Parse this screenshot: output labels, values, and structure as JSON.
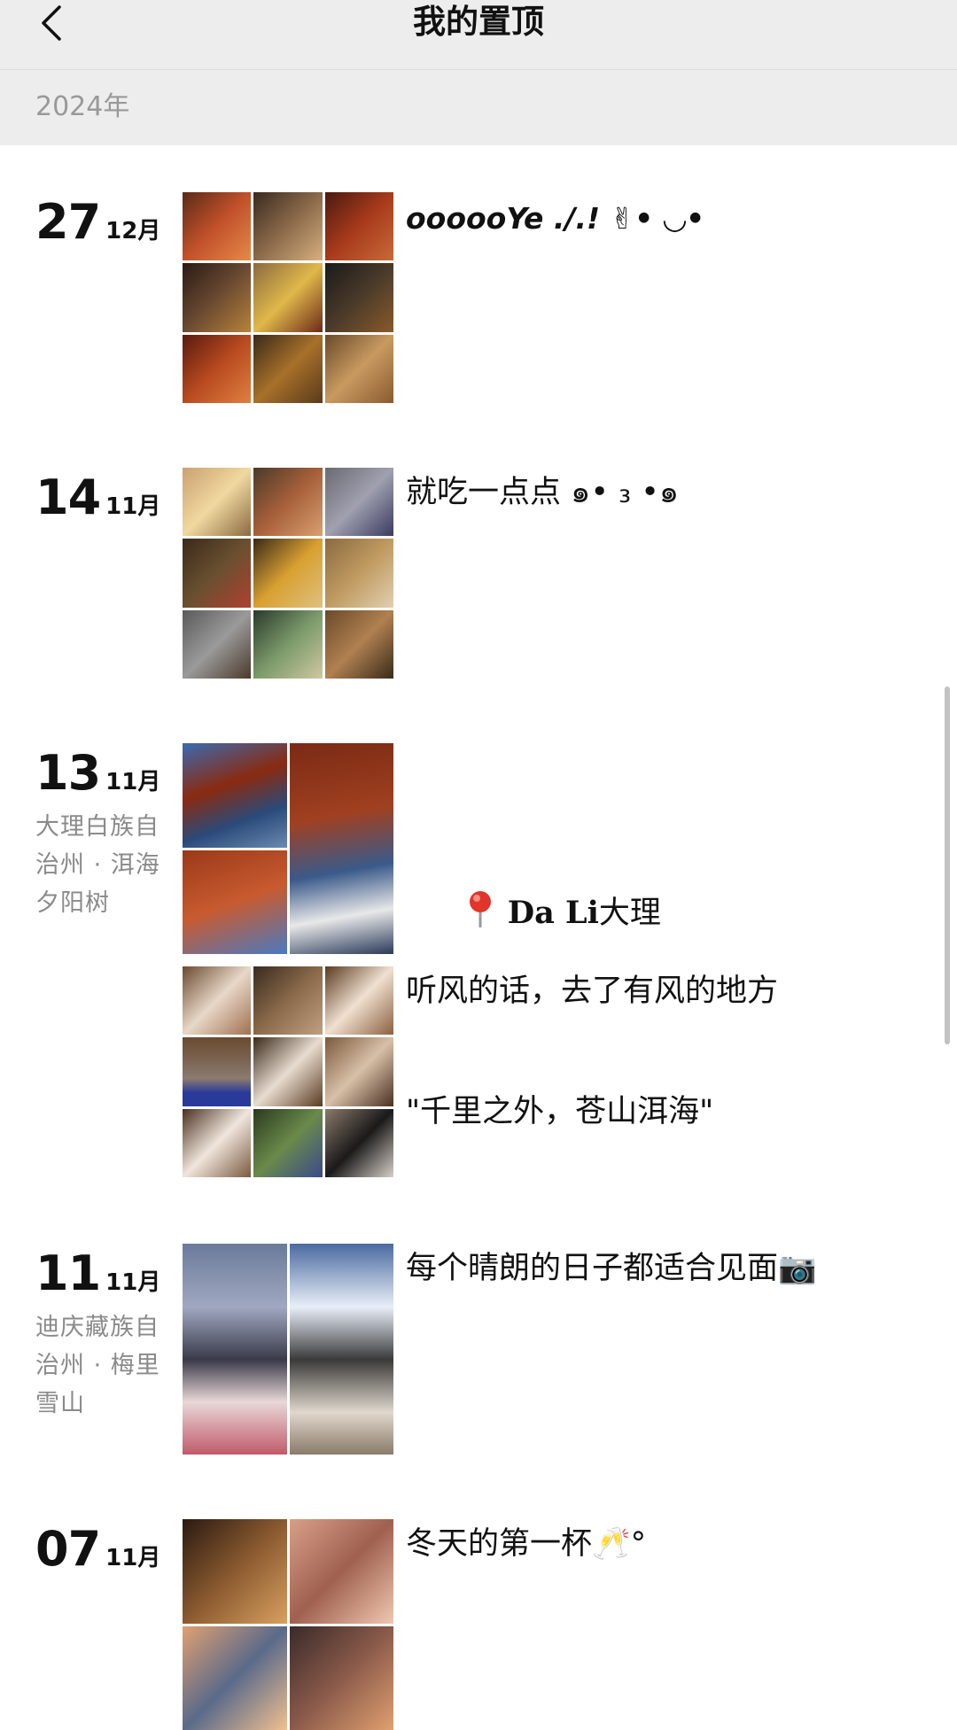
{
  "header": {
    "title": "我的置顶",
    "back_icon": "back-arrow-icon"
  },
  "year_label": "2024年",
  "posts": [
    {
      "day": "27",
      "month": "12月",
      "location": "",
      "text": "oooooYe ./.! ✌︎• ◡•"
    },
    {
      "day": "14",
      "month": "11月",
      "location": "",
      "text": "就吃一点点 ๑• ₃ •๑"
    },
    {
      "day": "13",
      "month": "11月",
      "location": "大理白族自治州 · 洱海夕阳树",
      "pin_icon": "location-pin-icon",
      "text_a_place": "Da Li",
      "text_a_city": "大理",
      "text_a_quote": "\"千里之外，苍山洱海\"",
      "text_b": "听风的话，去了有风的地方"
    },
    {
      "day": "11",
      "month": "11月",
      "location": "迪庆藏族自治州 · 梅里雪山",
      "text": "每个晴朗的日子都适合见面📷"
    },
    {
      "day": "07",
      "month": "11月",
      "location": "",
      "text": "冬天的第一杯🥂°"
    }
  ]
}
